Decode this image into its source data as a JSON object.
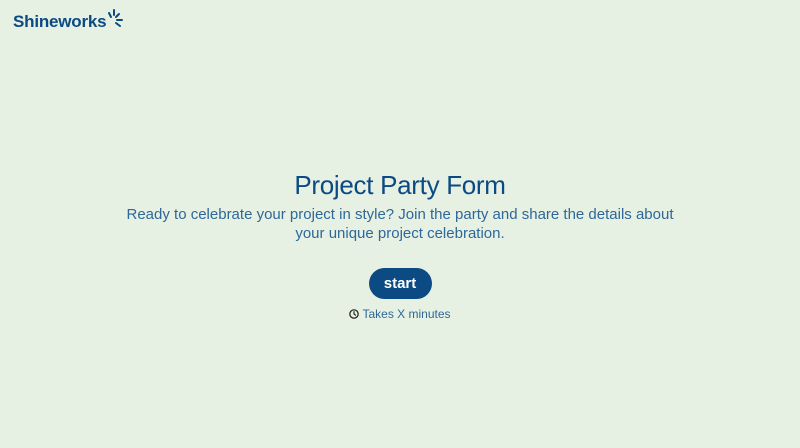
{
  "brand": {
    "name": "Shineworks",
    "icon": "sparkle-icon",
    "color": "#0b4a82"
  },
  "page": {
    "background": "#e6f0e3",
    "title": "Project Party Form",
    "description": "Ready to celebrate your project in style? Join the party and share the details about your unique project celebration."
  },
  "start_button": {
    "label": "start",
    "color": "#0b4a82"
  },
  "duration": {
    "icon": "clock-icon",
    "text": "Takes X minutes"
  }
}
